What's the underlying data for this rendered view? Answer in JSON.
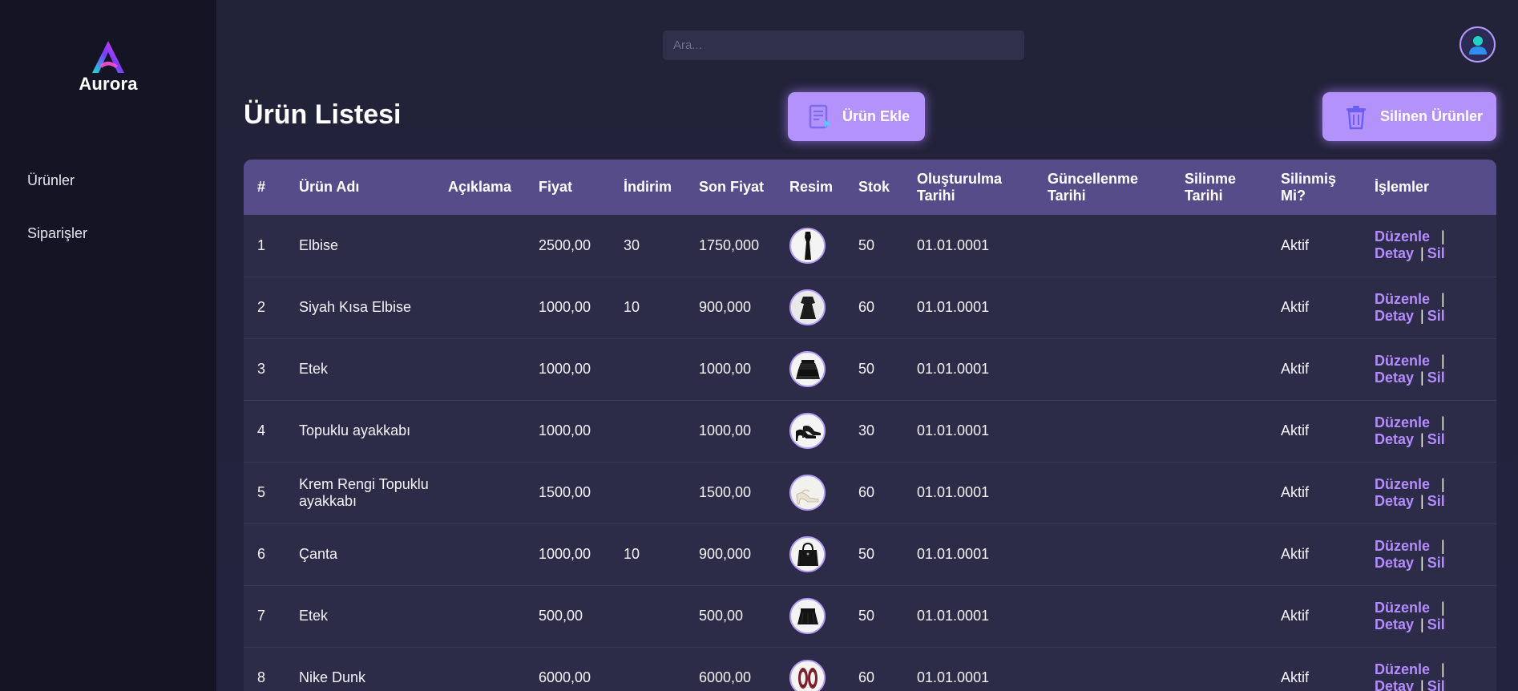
{
  "brand": {
    "name": "Aurora"
  },
  "sidebar": {
    "items": [
      {
        "label": "Ürünler"
      },
      {
        "label": "Siparişler"
      }
    ]
  },
  "search": {
    "placeholder": "Ara..."
  },
  "user": {
    "icon": "user-icon"
  },
  "page": {
    "title": "Ürün Listesi",
    "add_button": "Ürün Ekle",
    "deleted_button": "Silinen Ürünler"
  },
  "table": {
    "columns": [
      "#",
      "Ürün Adı",
      "Açıklama",
      "Fiyat",
      "İndirim",
      "Son Fiyat",
      "Resim",
      "Stok",
      "Oluşturulma Tarihi",
      "Güncellenme Tarihi",
      "Silinme Tarihi",
      "Silinmiş Mi?",
      "İşlemler"
    ],
    "actions": {
      "edit": "Düzenle",
      "detail": "Detay",
      "delete": "Sil"
    },
    "rows": [
      {
        "no": "1",
        "name": "Elbise",
        "desc": "",
        "price": "2500,00",
        "discount": "30",
        "final": "1750,000",
        "image": "long-black-dress",
        "stock": "50",
        "created": "01.01.0001",
        "updated": "",
        "deleted_at": "",
        "status": "Aktif"
      },
      {
        "no": "2",
        "name": "Siyah Kısa Elbise",
        "desc": "",
        "price": "1000,00",
        "discount": "10",
        "final": "900,000",
        "image": "short-black-dress",
        "stock": "60",
        "created": "01.01.0001",
        "updated": "",
        "deleted_at": "",
        "status": "Aktif"
      },
      {
        "no": "3",
        "name": "Etek",
        "desc": "",
        "price": "1000,00",
        "discount": "",
        "final": "1000,00",
        "image": "ruffled-skirt",
        "stock": "50",
        "created": "01.01.0001",
        "updated": "",
        "deleted_at": "",
        "status": "Aktif"
      },
      {
        "no": "4",
        "name": "Topuklu ayakkabı",
        "desc": "",
        "price": "1000,00",
        "discount": "",
        "final": "1000,00",
        "image": "black-heels",
        "stock": "30",
        "created": "01.01.0001",
        "updated": "",
        "deleted_at": "",
        "status": "Aktif"
      },
      {
        "no": "5",
        "name": "Krem Rengi Topuklu ayakkabı",
        "desc": "",
        "price": "1500,00",
        "discount": "",
        "final": "1500,00",
        "image": "cream-heels",
        "stock": "60",
        "created": "01.01.0001",
        "updated": "",
        "deleted_at": "",
        "status": "Aktif"
      },
      {
        "no": "6",
        "name": "Çanta",
        "desc": "",
        "price": "1000,00",
        "discount": "10",
        "final": "900,000",
        "image": "black-handbag",
        "stock": "50",
        "created": "01.01.0001",
        "updated": "",
        "deleted_at": "",
        "status": "Aktif"
      },
      {
        "no": "7",
        "name": "Etek",
        "desc": "",
        "price": "500,00",
        "discount": "",
        "final": "500,00",
        "image": "black-mini-skirt",
        "stock": "50",
        "created": "01.01.0001",
        "updated": "",
        "deleted_at": "",
        "status": "Aktif"
      },
      {
        "no": "8",
        "name": "Nike Dunk",
        "desc": "",
        "price": "6000,00",
        "discount": "",
        "final": "6000,00",
        "image": "sneakers",
        "stock": "60",
        "created": "01.01.0001",
        "updated": "",
        "deleted_at": "",
        "status": "Aktif"
      }
    ]
  },
  "colors": {
    "sidebar_bg": "#141424",
    "main_bg": "#23233a",
    "accent": "#b492fb",
    "header_row": "#574c8a",
    "link": "#b58cff"
  }
}
